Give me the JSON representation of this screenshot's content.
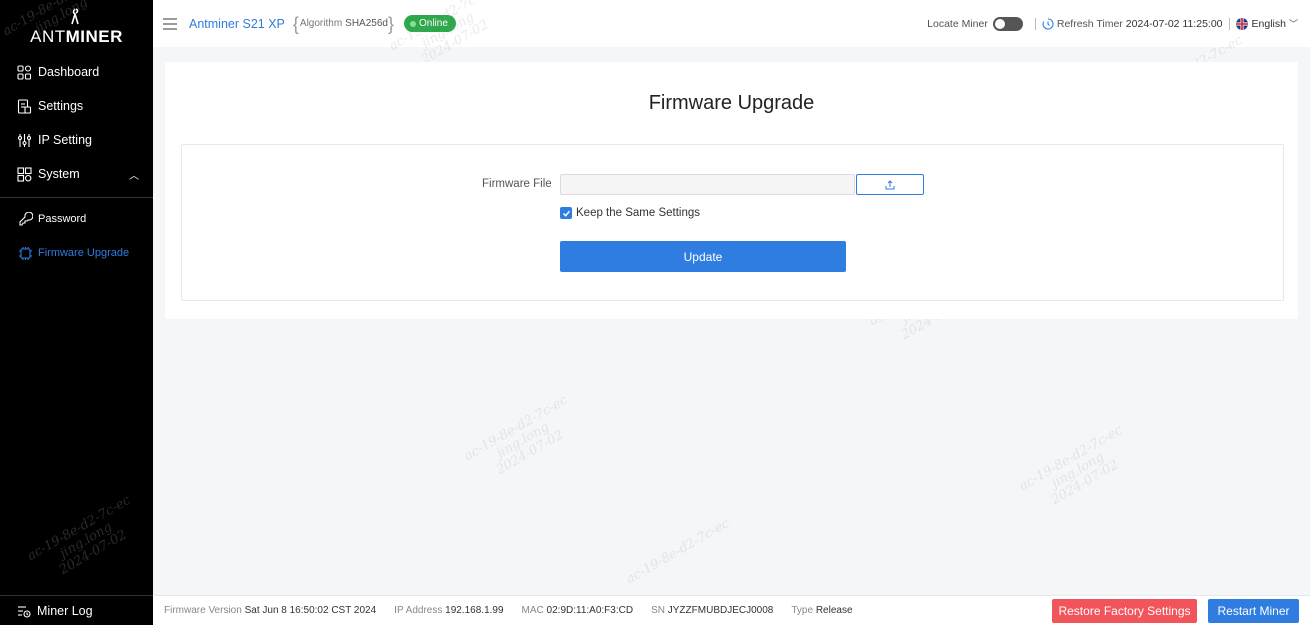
{
  "sidebar": {
    "logo_text_light": "ANT",
    "logo_text_bold": "MINER",
    "items": [
      {
        "label": "Dashboard",
        "icon": "dashboard-icon"
      },
      {
        "label": "Settings",
        "icon": "settings-icon"
      },
      {
        "label": "IP Setting",
        "icon": "ip-setting-icon"
      },
      {
        "label": "System",
        "icon": "system-icon",
        "expanded": true
      }
    ],
    "sub_items": [
      {
        "label": "Password",
        "icon": "password-icon",
        "active": false
      },
      {
        "label": "Firmware Upgrade",
        "icon": "firmware-icon",
        "active": true
      }
    ],
    "miner_log": "Miner Log"
  },
  "header": {
    "model": "Antminer S21 XP",
    "algorithm_label": "Algorithm",
    "algorithm_value": "SHA256d",
    "status": "Online",
    "locate_miner_label": "Locate Miner",
    "locate_miner_on": false,
    "refresh_label": "Refresh Timer",
    "refresh_time": "2024-07-02 11:25:00",
    "language": "English"
  },
  "main": {
    "title": "Firmware Upgrade",
    "firmware_file_label": "Firmware File",
    "firmware_file_value": "",
    "keep_settings_label": "Keep the Same Settings",
    "keep_settings_checked": true,
    "update_label": "Update"
  },
  "footer": {
    "firmware_version_label": "Firmware Version",
    "firmware_version": "Sat Jun 8 16:50:02 CST 2024",
    "ip_label": "IP Address",
    "ip": "192.168.1.99",
    "mac_label": "MAC",
    "mac": "02:9D:11:A0:F3:CD",
    "sn_label": "SN",
    "sn": "JYZZFMUBDJECJ0008",
    "type_label": "Type",
    "type": "Release",
    "restore_label": "Restore Factory Settings",
    "restart_label": "Restart Miner"
  },
  "watermark": {
    "line1": "ac-19-8e-d2-7c-ec",
    "line2": "jing.long",
    "line3": "2024-07-02"
  },
  "colors": {
    "accent": "#2f7de1",
    "online": "#2ca84b",
    "danger": "#f2545b",
    "sidebar_bg": "#000000"
  }
}
